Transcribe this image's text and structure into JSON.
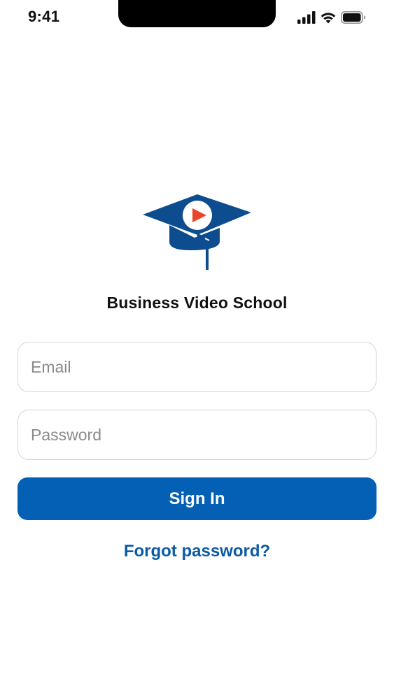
{
  "status_bar": {
    "time": "9:41",
    "icons": [
      "cellular-signal-icon",
      "wifi-icon",
      "battery-icon"
    ]
  },
  "logo": {
    "icon": "graduation-cap-play-icon",
    "colors": {
      "cap": "#0d4d8f",
      "play": "#e8452a",
      "circle": "#ffffff"
    }
  },
  "app": {
    "name": "Business Video School"
  },
  "form": {
    "email_placeholder": "Email",
    "password_placeholder": "Password",
    "email_value": "",
    "password_value": ""
  },
  "actions": {
    "sign_in_label": "Sign In",
    "forgot_label": "Forgot password?"
  },
  "colors": {
    "primary": "#0460b4",
    "link": "#0a5aa5",
    "border": "#d6d6d6"
  }
}
